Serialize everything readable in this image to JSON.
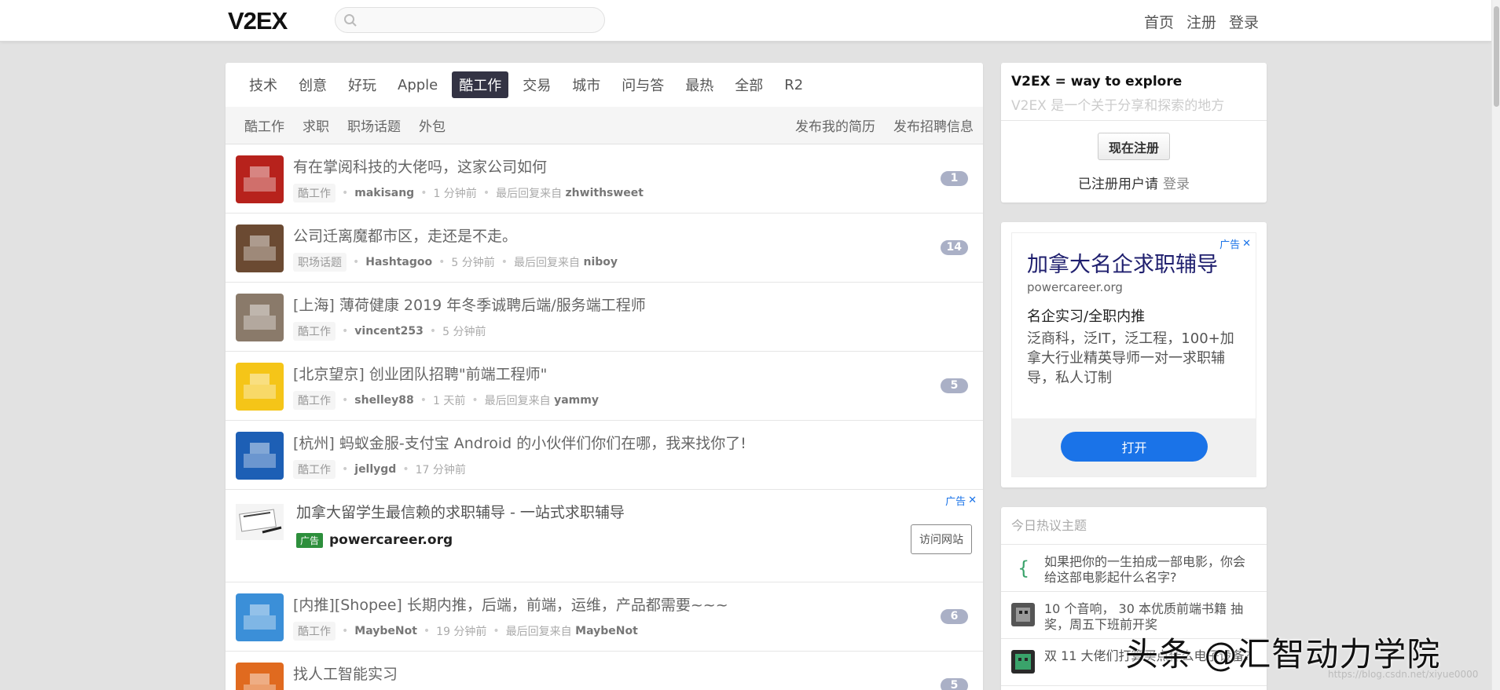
{
  "header": {
    "logo": "V2EX",
    "search_placeholder": "",
    "nav": [
      "首页",
      "注册",
      "登录"
    ]
  },
  "tabs": [
    "技术",
    "创意",
    "好玩",
    "Apple",
    "酷工作",
    "交易",
    "城市",
    "问与答",
    "最热",
    "全部",
    "R2"
  ],
  "active_tab": "酷工作",
  "subtabs_left": [
    "酷工作",
    "求职",
    "职场话题",
    "外包"
  ],
  "subtabs_right": [
    "发布我的简历",
    "发布招聘信息"
  ],
  "topics": [
    {
      "title": "有在掌阅科技的大佬吗，这家公司如何",
      "node": "酷工作",
      "user": "makisang",
      "time": "1 分钟前",
      "last_label": "最后回复来自",
      "last_user": "zhwithsweet",
      "count": "1",
      "avatar_color": "#b7221c"
    },
    {
      "title": "公司迁离魔都市区，走还是不走。",
      "node": "职场话题",
      "user": "Hashtagoo",
      "time": "5 分钟前",
      "last_label": "最后回复来自",
      "last_user": "niboy",
      "count": "14",
      "avatar_color": "#6b4a32"
    },
    {
      "title": "[上海] 薄荷健康 2019 年冬季诚聘后端/服务端工程师",
      "node": "酷工作",
      "user": "vincent253",
      "time": "5 分钟前",
      "last_label": "",
      "last_user": "",
      "count": "",
      "avatar_color": "#8a7a6a"
    },
    {
      "title": "[北京望京] 创业团队招聘\"前端工程师\"",
      "node": "酷工作",
      "user": "shelley88",
      "time": "1 天前",
      "last_label": "最后回复来自",
      "last_user": "yammy",
      "count": "5",
      "avatar_color": "#f5c518"
    },
    {
      "title": "[杭州] 蚂蚁金服-支付宝 Android 的小伙伴们你们在哪，我来找你了!",
      "node": "酷工作",
      "user": "jellygd",
      "time": "17 分钟前",
      "last_label": "",
      "last_user": "",
      "count": "",
      "avatar_color": "#1d5fb5"
    }
  ],
  "ad_row": {
    "title": "加拿大留学生最信赖的求职辅导 - 一站式求职辅导",
    "badge": "广告",
    "domain": "powercareer.org",
    "corner": "广告",
    "button": "访问网站"
  },
  "topics_after": [
    {
      "title": "[内推][Shopee] 长期内推，后端，前端，运维，产品都需要~~~",
      "node": "酷工作",
      "user": "MaybeNot",
      "time": "19 分钟前",
      "last_label": "最后回复来自",
      "last_user": "MaybeNot",
      "count": "6",
      "avatar_color": "#3b8fd8"
    },
    {
      "title": "找人工智能实习",
      "node": "",
      "user": "",
      "time": "",
      "last_label": "",
      "last_user": "",
      "count": "5",
      "avatar_color": "#e06a1f"
    }
  ],
  "sidebar": {
    "slogan": "V2EX = way to explore",
    "desc": "V2EX 是一个关于分享和探索的地方",
    "signup": "现在注册",
    "login_hint": "已注册用户请",
    "login": "登录",
    "ad": {
      "corner": "广告",
      "title": "加拿大名企求职辅导",
      "domain": "powercareer.org",
      "sub": "名企实习/全职内推",
      "body": "泛商科，泛IT，泛工程，100+加拿大行业精英导师一对一求职辅导，私人订制",
      "button": "打开"
    },
    "hot_title": "今日热议主题",
    "hot": [
      {
        "text": "如果把你的一生拍成一部电影，你会给这部电影起什么名字?"
      },
      {
        "text": "10 个音响， 30 本优质前端书籍 抽奖，周五下班前开奖"
      },
      {
        "text": "双 11 大佬们打算买点什么电子设备?"
      }
    ]
  },
  "watermark": "头条 @汇智动力学院",
  "watermark_url": "https://blog.csdn.net/xiyue0000"
}
